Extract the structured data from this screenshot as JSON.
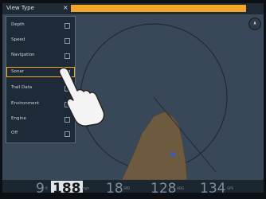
{
  "app": {
    "title": "View Type",
    "close_glyph": "×"
  },
  "menu": {
    "items": [
      {
        "label": "Depth",
        "checked": true
      },
      {
        "label": "Speed",
        "checked": true
      },
      {
        "label": "Navigation",
        "checked": true
      },
      {
        "label": "Sonar",
        "checked": false,
        "selected": true
      },
      {
        "label": "Trail Data",
        "checked": false
      },
      {
        "label": "Environment",
        "checked": true
      },
      {
        "label": "Engine",
        "checked": true
      },
      {
        "label": "Off",
        "checked": true
      }
    ]
  },
  "readouts": {
    "r1": "9",
    "r2": "188",
    "r3": "18",
    "r4": "128",
    "r5": "134",
    "u1": "ft",
    "u2": "mph",
    "u3": "SPD",
    "u4": "HDG",
    "u5": "GPS"
  },
  "colors": {
    "accent": "#f5a623",
    "water": "#384858",
    "land": "#7a6244"
  },
  "icons": {
    "compass": "compass-icon",
    "hand": "pointing-hand-icon"
  }
}
